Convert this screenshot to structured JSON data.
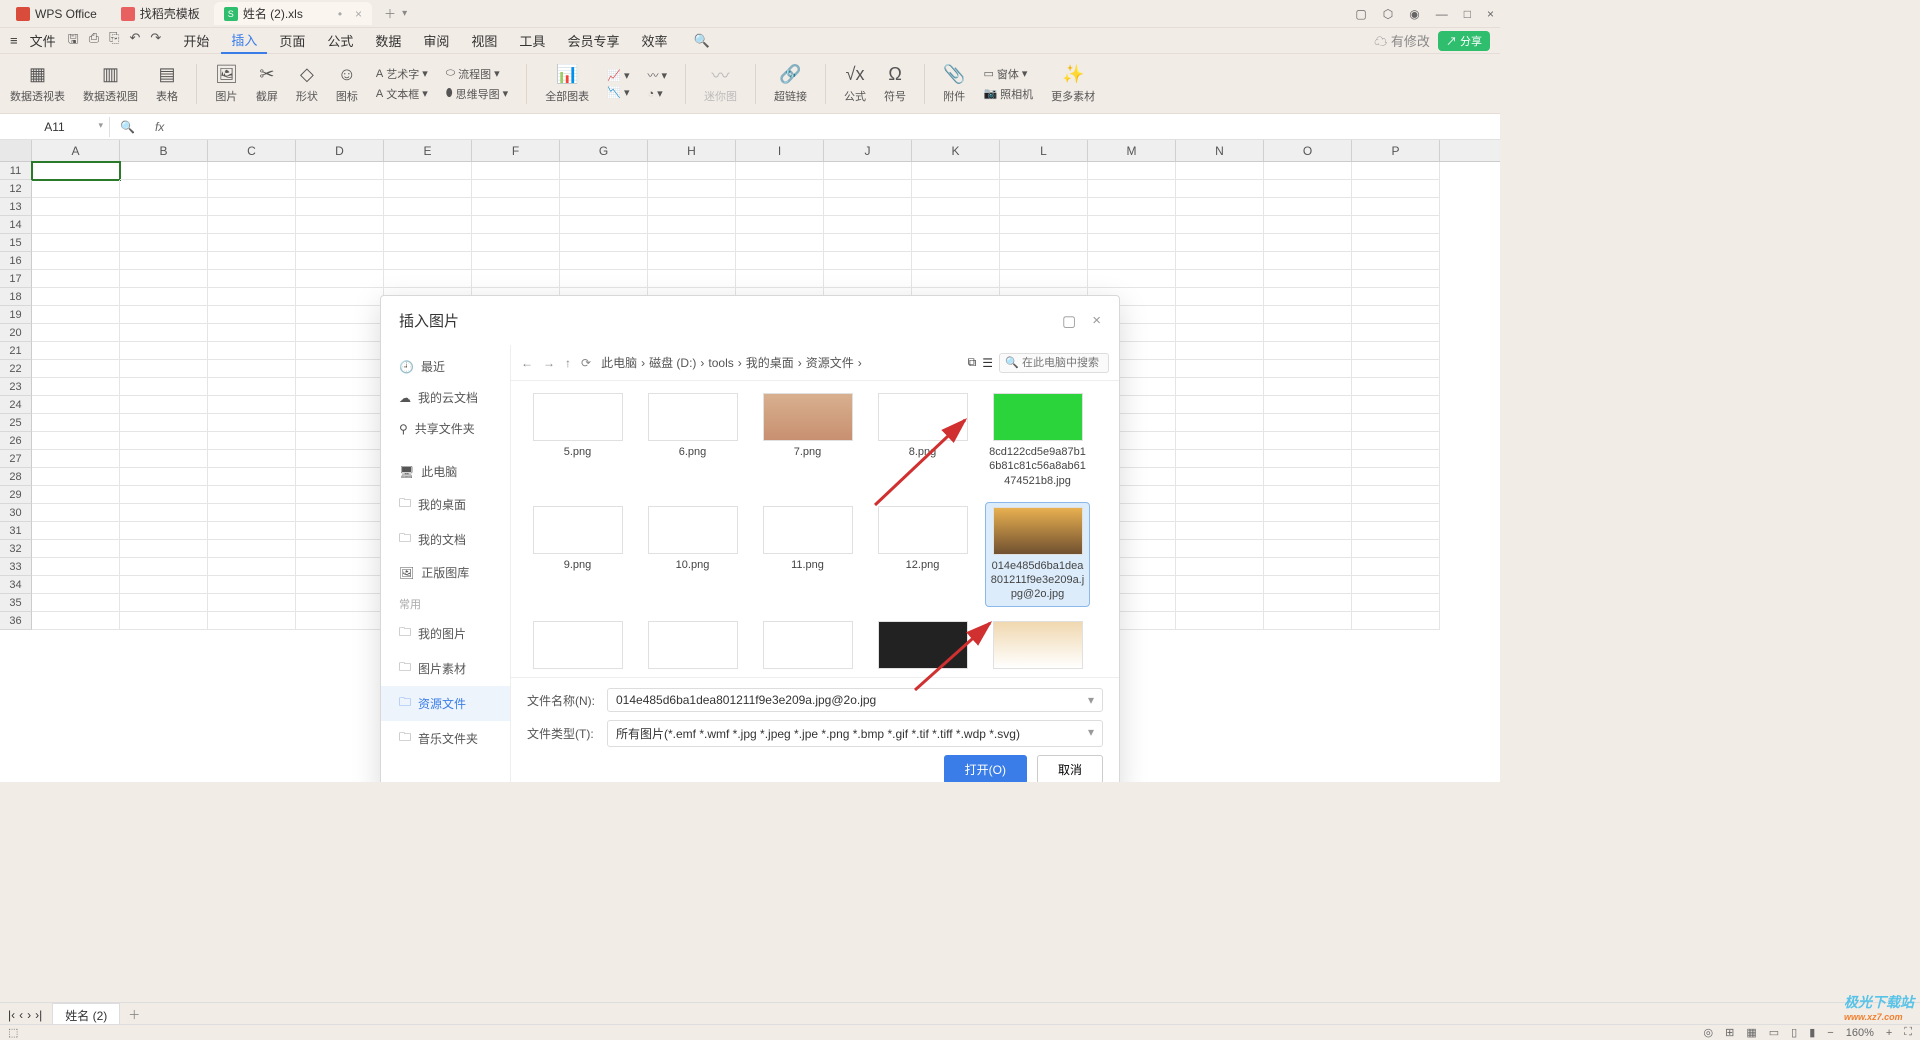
{
  "tabs": [
    {
      "label": "WPS Office",
      "icon": "#d94b3a"
    },
    {
      "label": "找稻壳模板",
      "icon": "#e86060"
    },
    {
      "label": "姓名 (2).xls",
      "icon": "#2fbd6e",
      "active": true
    }
  ],
  "menu": {
    "file": "文件",
    "items": [
      "开始",
      "插入",
      "页面",
      "公式",
      "数据",
      "审阅",
      "视图",
      "工具",
      "会员专享",
      "效率"
    ],
    "active": "插入",
    "modify": "有修改",
    "share": "分享"
  },
  "ribbon": [
    {
      "label": "数据透视表"
    },
    {
      "label": "数据透视图"
    },
    {
      "label": "表格"
    },
    {
      "label": "图片"
    },
    {
      "label": "截屏"
    },
    {
      "label": "形状"
    },
    {
      "label": "图标"
    },
    {
      "label": "全部图表"
    },
    {
      "label": "迷你图"
    },
    {
      "label": "超链接"
    },
    {
      "label": "公式"
    },
    {
      "label": "符号"
    },
    {
      "label": "附件"
    },
    {
      "label": "照相机"
    },
    {
      "label": "更多素材"
    }
  ],
  "ribbon_small": {
    "art": "艺术字",
    "flow": "流程图",
    "text": "文本框",
    "mind": "思维导图",
    "shape": "窗体"
  },
  "cellref": "A11",
  "columns": [
    "A",
    "B",
    "C",
    "D",
    "E",
    "F",
    "G",
    "H",
    "I",
    "J",
    "K",
    "L",
    "M",
    "N",
    "O",
    "P"
  ],
  "rowstart": 11,
  "rowcount": 26,
  "dialog": {
    "title": "插入图片",
    "side": {
      "recent": "最近",
      "cloud": "我的云文档",
      "share": "共享文件夹",
      "pc": "此电脑",
      "desktop": "我的桌面",
      "docs": "我的文档",
      "gallery": "正版图库",
      "common": "常用",
      "pics": "我的图片",
      "mat": "图片素材",
      "res": "资源文件",
      "music": "音乐文件夹"
    },
    "crumb": [
      "此电脑",
      "磁盘 (D:)",
      "tools",
      "我的桌面",
      "资源文件"
    ],
    "search_ph": "在此电脑中搜索",
    "files": [
      {
        "name": "5.png"
      },
      {
        "name": "6.png"
      },
      {
        "name": "7.png"
      },
      {
        "name": "8.png"
      },
      {
        "name": "8cd122cd5e9a87b16b81c81c56a8ab61474521b8.jpg"
      },
      {
        "name": "9.png"
      },
      {
        "name": "10.png"
      },
      {
        "name": "11.png"
      },
      {
        "name": "12.png"
      },
      {
        "name": "014e485d6ba1dea801211f9e3e209a.jpg@2o.jpg",
        "sel": true
      },
      {
        "name": ""
      },
      {
        "name": ""
      },
      {
        "name": ""
      },
      {
        "name": ""
      },
      {
        "name": ""
      }
    ],
    "fname_label": "文件名称(N):",
    "fname_value": "014e485d6ba1dea801211f9e3e209a.jpg@2o.jpg",
    "ftype_label": "文件类型(T):",
    "ftype_value": "所有图片(*.emf *.wmf *.jpg *.jpeg *.jpe *.png *.bmp *.gif *.tif *.tiff *.wdp *.svg)",
    "open": "打开(O)",
    "cancel": "取消"
  },
  "sheet": "姓名 (2)",
  "zoom": "160%",
  "watermark": {
    "title": "极光下载站",
    "url": "www.xz7.com"
  }
}
